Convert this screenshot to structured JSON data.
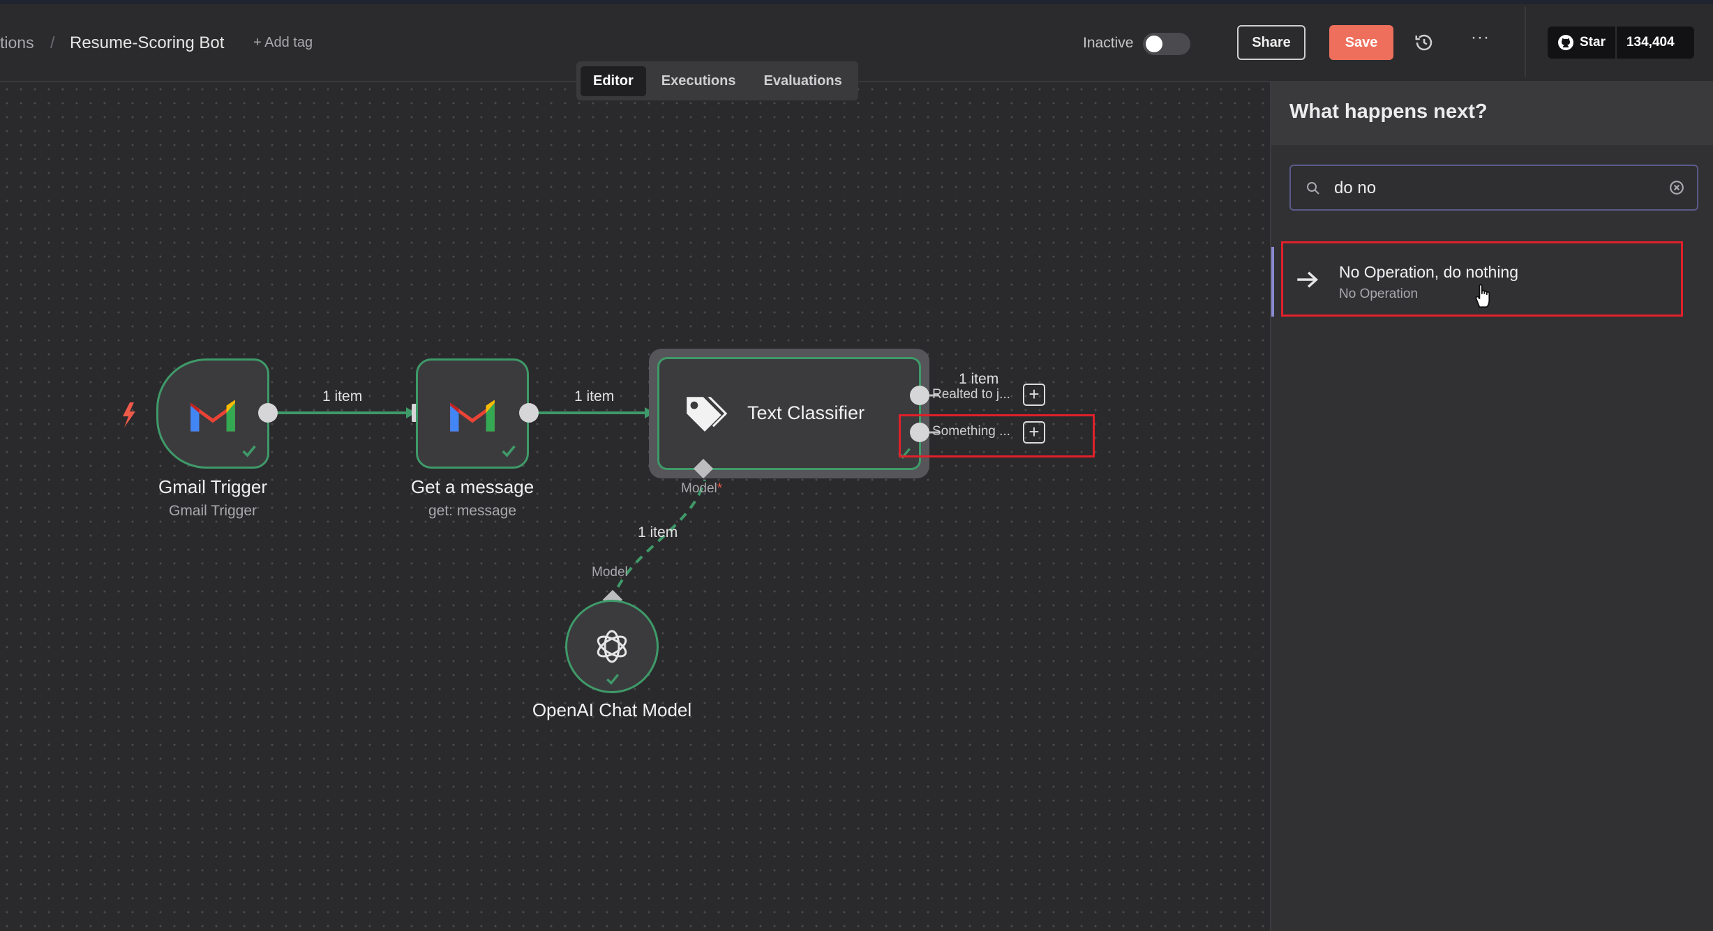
{
  "header": {
    "breadcrumb_prev": "tions",
    "breadcrumb_sep": "/",
    "workflow_name": "Resume-Scoring Bot",
    "add_tag": "+ Add tag",
    "active_label": "Inactive",
    "share": "Share",
    "save": "Save",
    "more": "···",
    "github_star": "Star",
    "github_count": "134,404"
  },
  "tabs": [
    "Editor",
    "Executions",
    "Evaluations"
  ],
  "active_tab": "Editor",
  "canvas": {
    "nodes": {
      "gmail_trigger": {
        "title": "Gmail Trigger",
        "subtitle": "Gmail Trigger"
      },
      "get_message": {
        "title": "Get a message",
        "subtitle": "get: message"
      },
      "text_classifier": {
        "title": "Text Classifier",
        "model_port": "Model",
        "model_required": "*"
      },
      "openai_model": {
        "title": "OpenAI Chat Model",
        "port": "Model"
      }
    },
    "connections": {
      "c1": "1 item",
      "c2": "1 item",
      "c3": "1 item",
      "out1_count": "1 item",
      "out1": "Realted to j...",
      "out2": "Something ..."
    }
  },
  "panel": {
    "title": "What happens next?",
    "search_value": "do no",
    "results": [
      {
        "title": "No Operation, do nothing",
        "subtitle": "No Operation"
      }
    ]
  },
  "colors": {
    "accent_save": "#ee6f5c",
    "node_border_success": "#3f9a69",
    "highlight": "#e0202a"
  }
}
